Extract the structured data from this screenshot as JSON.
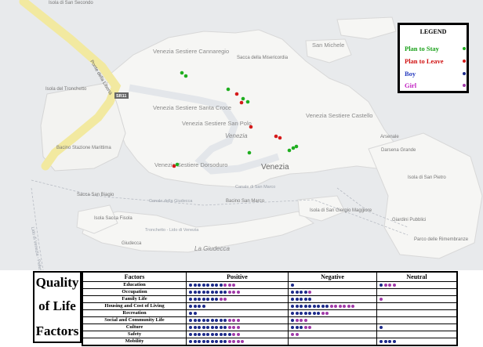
{
  "map": {
    "labels": [
      {
        "text": "Isola di San Secondo",
        "kind": "small"
      },
      {
        "text": "Venezia Sestiere Cannaregio",
        "kind": "district"
      },
      {
        "text": "Sacca della Misericordia",
        "kind": "small"
      },
      {
        "text": "San Michele",
        "kind": "district"
      },
      {
        "text": "Isola del Tronchetto",
        "kind": "small"
      },
      {
        "text": "Ponte della Libertà",
        "kind": "road"
      },
      {
        "text": "SR11",
        "kind": "shield"
      },
      {
        "text": "Venezia Sestiere Santa Croce",
        "kind": "district"
      },
      {
        "text": "Venezia Sestiere San Polo",
        "kind": "district"
      },
      {
        "text": "Venezia",
        "kind": "italic"
      },
      {
        "text": "Venezia Sestiere Castello",
        "kind": "district"
      },
      {
        "text": "Arsenale",
        "kind": "small"
      },
      {
        "text": "Darsena Grande",
        "kind": "small"
      },
      {
        "text": "Venezia",
        "kind": "city"
      },
      {
        "text": "Bacino Stazione Marittima",
        "kind": "small"
      },
      {
        "text": "Venezia Sestiere Dorsoduro",
        "kind": "district"
      },
      {
        "text": "Isola di San Pietro",
        "kind": "small"
      },
      {
        "text": "Canale della Giudecca",
        "kind": "water"
      },
      {
        "text": "Canale di San Marco",
        "kind": "water"
      },
      {
        "text": "Bacino San Marco",
        "kind": "small"
      },
      {
        "text": "Isola di San Giorgio Maggiore",
        "kind": "small"
      },
      {
        "text": "Giardini Pubblici",
        "kind": "small"
      },
      {
        "text": "Parco delle Rimembranze",
        "kind": "small"
      },
      {
        "text": "Isola Sacca Fisola",
        "kind": "small"
      },
      {
        "text": "Giudecca",
        "kind": "small"
      },
      {
        "text": "La Giudecca",
        "kind": "italic"
      },
      {
        "text": "Tronchetto - Lido di Venezia",
        "kind": "water"
      },
      {
        "text": "Sacca San Biagio",
        "kind": "small"
      },
      {
        "text": "Lido di Venezia - Pellestrina",
        "kind": "water"
      }
    ],
    "markers": [
      {
        "type": "stay"
      },
      {
        "type": "stay"
      },
      {
        "type": "stay"
      },
      {
        "type": "leave"
      },
      {
        "type": "leave"
      },
      {
        "type": "stay"
      },
      {
        "type": "stay"
      },
      {
        "type": "stay"
      },
      {
        "type": "leave"
      },
      {
        "type": "leave"
      },
      {
        "type": "leave"
      },
      {
        "type": "stay"
      },
      {
        "type": "stay"
      },
      {
        "type": "stay"
      },
      {
        "type": "leave"
      },
      {
        "type": "stay"
      }
    ]
  },
  "legend": {
    "title": "LEGEND",
    "items": [
      {
        "label": "Plan to Stay",
        "color": "#1fae1f",
        "text_color": "#18a018"
      },
      {
        "label": "Plan to Leave",
        "color": "#d51a1a",
        "text_color": "#d01010"
      },
      {
        "label": "Boy",
        "color": "#1c2a8a",
        "text_color": "#2a3fc0"
      },
      {
        "label": "Girl",
        "color": "#a03aa8",
        "text_color": "#c020c0"
      }
    ]
  },
  "qol": {
    "line1": "Quality",
    "line2": "of Life",
    "line3": "Factors"
  },
  "table": {
    "headers": {
      "factors": "Factors",
      "positive": "Positive",
      "negative": "Negative",
      "neutral": "Neutral"
    },
    "rows": [
      {
        "factor": "Education",
        "positive": "BBBBBBBBGGG",
        "negative": "B",
        "neutral": "BGGG"
      },
      {
        "factor": "Occupation",
        "positive": "BBBBBBBBBGGG",
        "negative": "BBBBG",
        "neutral": ""
      },
      {
        "factor": "Family Life",
        "positive": "BBBBBBBGG",
        "negative": "BBBBB",
        "neutral": "G"
      },
      {
        "factor": "Housing and Cost of Living",
        "positive": "BBBB",
        "negative": "BBBBBBBBBGGGGGG",
        "neutral": ""
      },
      {
        "factor": "Recreation",
        "positive": "BB",
        "negative": "BBBBBBBGG",
        "neutral": ""
      },
      {
        "factor": "Social and Community Life",
        "positive": "BBBBBBBBBGGG",
        "negative": "BGGG",
        "neutral": ""
      },
      {
        "factor": "Culture",
        "positive": "BBBBBBBBBGGG",
        "negative": "BBBGG",
        "neutral": "B"
      },
      {
        "factor": "Safety",
        "positive": "BBBBBBBBBBGG",
        "negative": "GG",
        "neutral": ""
      },
      {
        "factor": "Mobility",
        "positive": "BBBBBBBBBGGGG",
        "negative": "",
        "neutral": "BBBB"
      }
    ]
  }
}
